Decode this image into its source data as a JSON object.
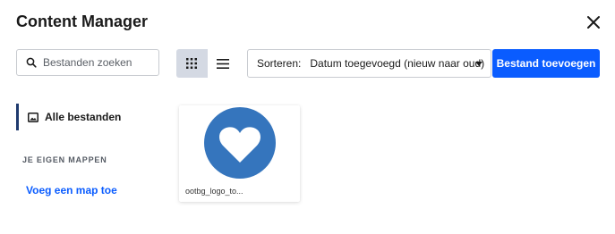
{
  "header": {
    "title": "Content Manager"
  },
  "toolbar": {
    "search_placeholder": "Bestanden zoeken",
    "sort_label": "Sorteren:",
    "sort_value": "Datum toegevoegd (nieuw naar oud)",
    "add_button_label": "Bestand toevoegen",
    "view_mode": "grid"
  },
  "sidebar": {
    "all_files_label": "Alle bestanden",
    "section_heading": "JE EIGEN MAPPEN",
    "add_folder_label": "Voeg een map toe"
  },
  "assets": [
    {
      "name": "ootbg_logo_to...",
      "thumb_icon": "heart-logo",
      "thumb_color": "#3575bd"
    }
  ],
  "colors": {
    "accent": "#0a5cff",
    "active_bar": "#1f3a6e",
    "logo_blue": "#3575bd"
  }
}
